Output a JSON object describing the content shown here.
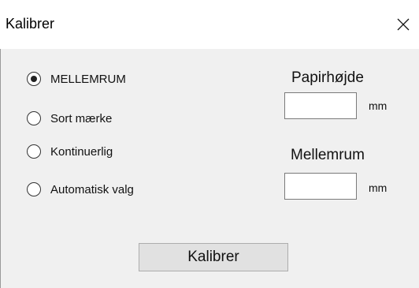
{
  "window": {
    "title": "Kalibrer"
  },
  "radios": [
    {
      "label": "MELLEMRUM",
      "checked": true
    },
    {
      "label": "Sort mærke",
      "checked": false
    },
    {
      "label": "Kontinuerlig",
      "checked": false
    },
    {
      "label": "Automatisk valg",
      "checked": false
    }
  ],
  "paper_height": {
    "label": "Papirhøjde",
    "value": "",
    "unit": "mm"
  },
  "gap": {
    "label": "Mellemrum",
    "value": "",
    "unit": "mm"
  },
  "button": {
    "label": "Kalibrer"
  },
  "icons": {
    "close": "close-icon",
    "radio_selected": "radio-selected-icon"
  }
}
